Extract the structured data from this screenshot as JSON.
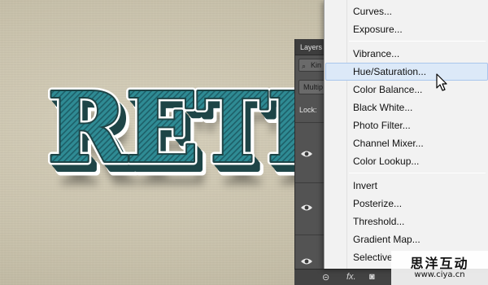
{
  "artwork": {
    "text": "RETRO",
    "colors": {
      "face": "#2f8b94",
      "stripe": "#1d5f68",
      "outline": "#ffffff",
      "extrude": "#1e4547",
      "shadow": "#000000"
    }
  },
  "layers_panel": {
    "title": "Layers",
    "filter_label": "Kin",
    "blend_mode": "Multip",
    "lock_label": "Lock:"
  },
  "adjustments_menu": {
    "items": [
      {
        "label": "Curves..."
      },
      {
        "label": "Exposure..."
      },
      {
        "label": "Vibrance..."
      },
      {
        "label": "Hue/Saturation...",
        "highlighted": true
      },
      {
        "label": "Color Balance..."
      },
      {
        "label": "Black  White..."
      },
      {
        "label": "Photo Filter..."
      },
      {
        "label": "Channel Mixer..."
      },
      {
        "label": "Color Lookup..."
      },
      {
        "label": "Invert"
      },
      {
        "label": "Posterize..."
      },
      {
        "label": "Threshold..."
      },
      {
        "label": "Gradient Map..."
      },
      {
        "label": "Selective"
      }
    ]
  },
  "bottom_bar": {
    "fx_label": "fx."
  },
  "watermark": {
    "top": "思洋互动",
    "bottom": "www.ciya.cn"
  }
}
